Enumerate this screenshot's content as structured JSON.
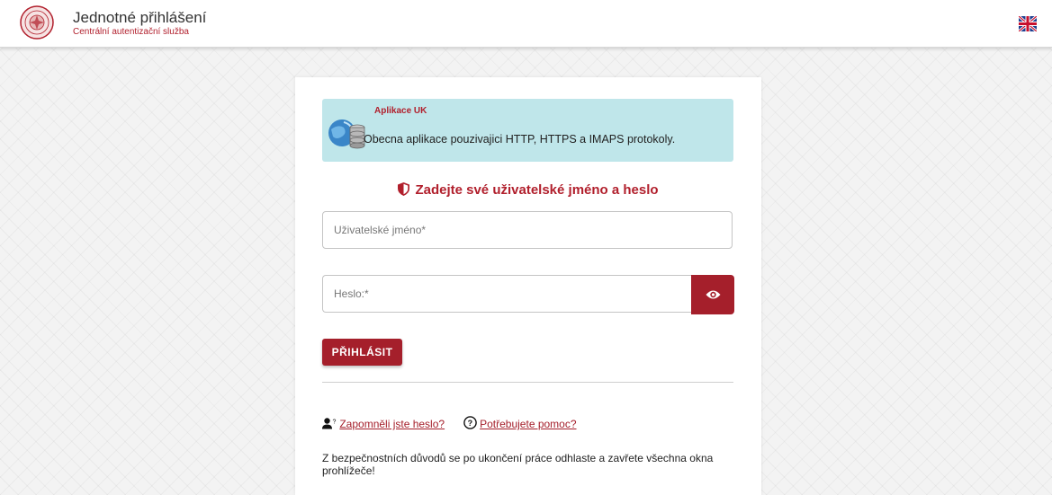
{
  "header": {
    "title": "Jednotné přihlášení",
    "subtitle": "Centrální autentizační služba",
    "language_icon": "uk-flag-icon"
  },
  "app_info": {
    "title": "Aplikace UK",
    "description": "Obecna aplikace pouzivajici HTTP, HTTPS a IMAPS protokoly."
  },
  "form": {
    "heading": "Zadejte své uživatelské jméno a heslo",
    "username_placeholder": "Uživatelské jméno*",
    "username_value": "",
    "password_placeholder": "Heslo:*",
    "password_value": "",
    "login_label": "PŘIHLÁSIT"
  },
  "links": {
    "forgot_password": "Zapomněli jste heslo?",
    "need_help": "Potřebujete pomoc?"
  },
  "security_note": "Z bezpečnostních důvodů se po ukončení práce odhlaste a zavřete všechna okna prohlížeče!",
  "colors": {
    "accent": "#a51f2b",
    "info_background": "#bfe6ea"
  }
}
